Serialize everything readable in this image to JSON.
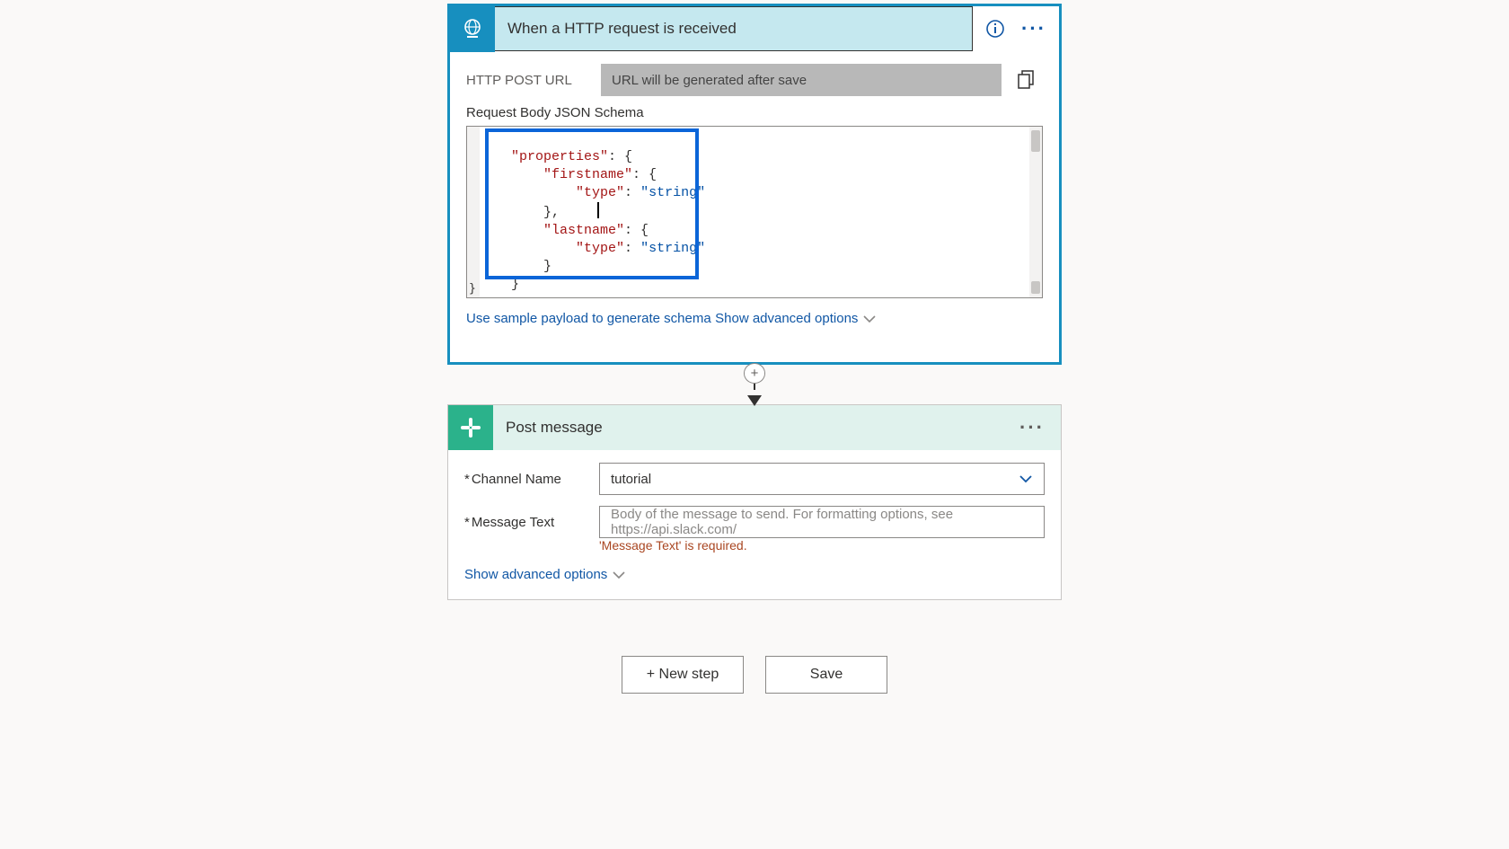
{
  "trigger": {
    "title": "When a HTTP request is received",
    "http_post_url_label": "HTTP POST URL",
    "url_placeholder": "URL will be generated after save",
    "schema_label": "Request Body JSON Schema",
    "schema": {
      "line1_key": "\"properties\"",
      "line1_rest": ": {",
      "line2_key": "\"firstname\"",
      "line2_rest": ": {",
      "line3_key": "\"type\"",
      "line3_colon": ": ",
      "line3_val": "\"string\"",
      "line4": "},",
      "line5_key": "\"lastname\"",
      "line5_rest": ": {",
      "line6_key": "\"type\"",
      "line6_colon": ": ",
      "line6_val": "\"string\"",
      "line7": "}",
      "line8": "}",
      "bottom_brace": "}"
    },
    "sample_link": "Use sample payload to generate schema",
    "advanced": "Show advanced options"
  },
  "slack": {
    "title": "Post message",
    "channel_label": "Channel Name",
    "channel_value": "tutorial",
    "message_label": "Message Text",
    "message_placeholder": "Body of the message to send. For formatting options, see https://api.slack.com/",
    "message_error": "'Message Text' is required.",
    "advanced": "Show advanced options"
  },
  "footer": {
    "new_step": "+ New step",
    "save": "Save"
  }
}
